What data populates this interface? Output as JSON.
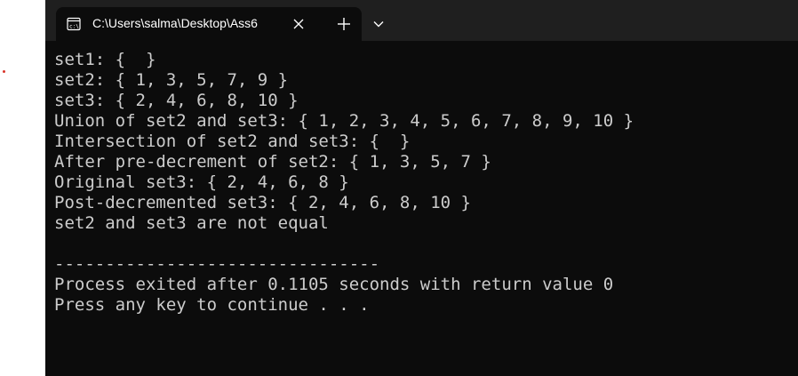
{
  "window": {
    "tab_title": "C:\\Users\\salma\\Desktop\\Ass6",
    "tab_icon": "terminal-icon",
    "close_icon": "close-icon",
    "new_tab_icon": "plus-icon",
    "dropdown_icon": "chevron-down-icon"
  },
  "console": {
    "lines": [
      "set1: {  }",
      "set2: { 1, 3, 5, 7, 9 }",
      "set3: { 2, 4, 6, 8, 10 }",
      "Union of set2 and set3: { 1, 2, 3, 4, 5, 6, 7, 8, 9, 10 }",
      "Intersection of set2 and set3: {  }",
      "After pre-decrement of set2: { 1, 3, 5, 7 }",
      "Original set3: { 2, 4, 6, 8 }",
      "Post-decremented set3: { 2, 4, 6, 8, 10 }",
      "set2 and set3 are not equal",
      "",
      "--------------------------------",
      "Process exited after 0.1105 seconds with return value 0",
      "Press any key to continue . . ."
    ]
  },
  "colors": {
    "background": "#0c0c0c",
    "titlebar": "#1f1f1f",
    "text": "#cccccc"
  }
}
